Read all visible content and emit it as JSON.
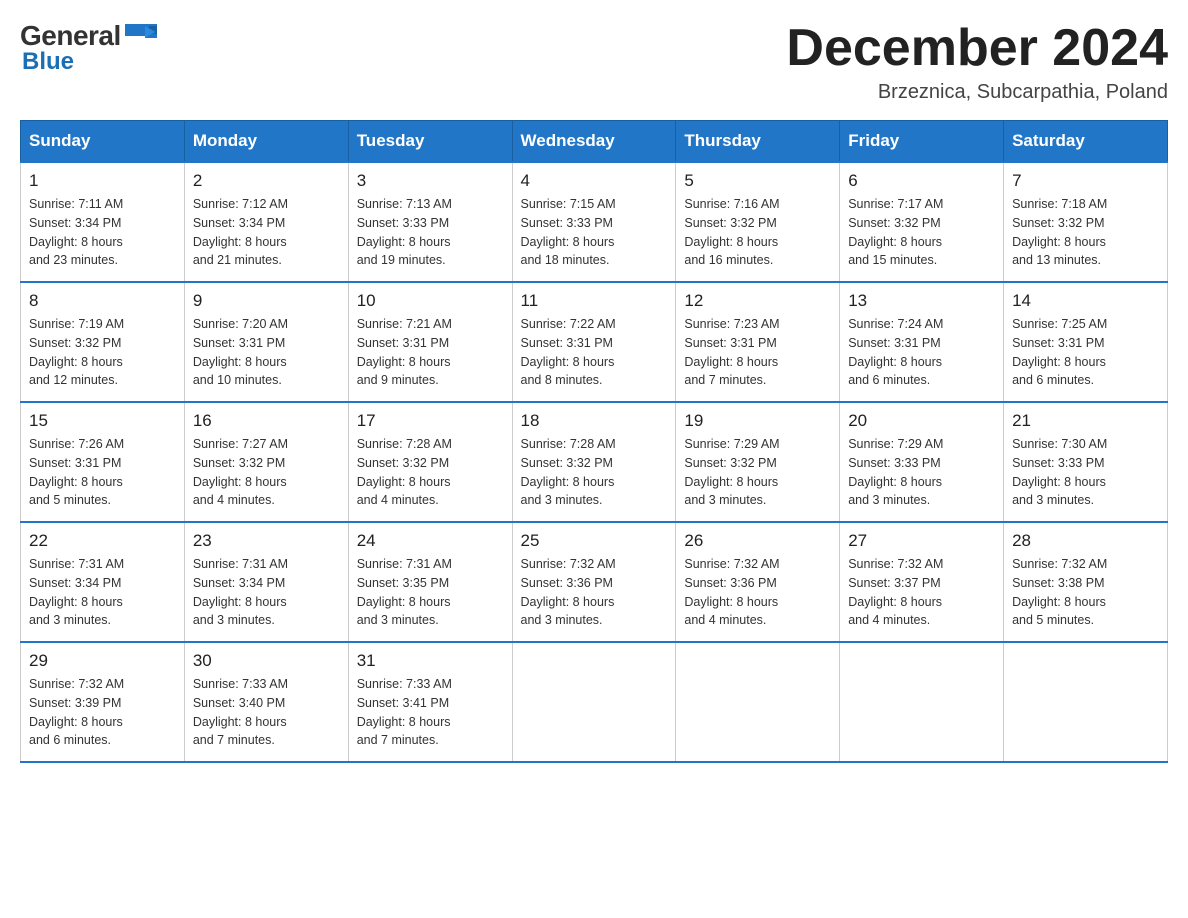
{
  "logo": {
    "general": "General",
    "blue": "Blue"
  },
  "title": "December 2024",
  "location": "Brzeznica, Subcarpathia, Poland",
  "headers": [
    "Sunday",
    "Monday",
    "Tuesday",
    "Wednesday",
    "Thursday",
    "Friday",
    "Saturday"
  ],
  "weeks": [
    [
      {
        "day": "1",
        "sunrise": "7:11 AM",
        "sunset": "3:34 PM",
        "daylight": "8 hours and 23 minutes."
      },
      {
        "day": "2",
        "sunrise": "7:12 AM",
        "sunset": "3:34 PM",
        "daylight": "8 hours and 21 minutes."
      },
      {
        "day": "3",
        "sunrise": "7:13 AM",
        "sunset": "3:33 PM",
        "daylight": "8 hours and 19 minutes."
      },
      {
        "day": "4",
        "sunrise": "7:15 AM",
        "sunset": "3:33 PM",
        "daylight": "8 hours and 18 minutes."
      },
      {
        "day": "5",
        "sunrise": "7:16 AM",
        "sunset": "3:32 PM",
        "daylight": "8 hours and 16 minutes."
      },
      {
        "day": "6",
        "sunrise": "7:17 AM",
        "sunset": "3:32 PM",
        "daylight": "8 hours and 15 minutes."
      },
      {
        "day": "7",
        "sunrise": "7:18 AM",
        "sunset": "3:32 PM",
        "daylight": "8 hours and 13 minutes."
      }
    ],
    [
      {
        "day": "8",
        "sunrise": "7:19 AM",
        "sunset": "3:32 PM",
        "daylight": "8 hours and 12 minutes."
      },
      {
        "day": "9",
        "sunrise": "7:20 AM",
        "sunset": "3:31 PM",
        "daylight": "8 hours and 10 minutes."
      },
      {
        "day": "10",
        "sunrise": "7:21 AM",
        "sunset": "3:31 PM",
        "daylight": "8 hours and 9 minutes."
      },
      {
        "day": "11",
        "sunrise": "7:22 AM",
        "sunset": "3:31 PM",
        "daylight": "8 hours and 8 minutes."
      },
      {
        "day": "12",
        "sunrise": "7:23 AM",
        "sunset": "3:31 PM",
        "daylight": "8 hours and 7 minutes."
      },
      {
        "day": "13",
        "sunrise": "7:24 AM",
        "sunset": "3:31 PM",
        "daylight": "8 hours and 6 minutes."
      },
      {
        "day": "14",
        "sunrise": "7:25 AM",
        "sunset": "3:31 PM",
        "daylight": "8 hours and 6 minutes."
      }
    ],
    [
      {
        "day": "15",
        "sunrise": "7:26 AM",
        "sunset": "3:31 PM",
        "daylight": "8 hours and 5 minutes."
      },
      {
        "day": "16",
        "sunrise": "7:27 AM",
        "sunset": "3:32 PM",
        "daylight": "8 hours and 4 minutes."
      },
      {
        "day": "17",
        "sunrise": "7:28 AM",
        "sunset": "3:32 PM",
        "daylight": "8 hours and 4 minutes."
      },
      {
        "day": "18",
        "sunrise": "7:28 AM",
        "sunset": "3:32 PM",
        "daylight": "8 hours and 3 minutes."
      },
      {
        "day": "19",
        "sunrise": "7:29 AM",
        "sunset": "3:32 PM",
        "daylight": "8 hours and 3 minutes."
      },
      {
        "day": "20",
        "sunrise": "7:29 AM",
        "sunset": "3:33 PM",
        "daylight": "8 hours and 3 minutes."
      },
      {
        "day": "21",
        "sunrise": "7:30 AM",
        "sunset": "3:33 PM",
        "daylight": "8 hours and 3 minutes."
      }
    ],
    [
      {
        "day": "22",
        "sunrise": "7:31 AM",
        "sunset": "3:34 PM",
        "daylight": "8 hours and 3 minutes."
      },
      {
        "day": "23",
        "sunrise": "7:31 AM",
        "sunset": "3:34 PM",
        "daylight": "8 hours and 3 minutes."
      },
      {
        "day": "24",
        "sunrise": "7:31 AM",
        "sunset": "3:35 PM",
        "daylight": "8 hours and 3 minutes."
      },
      {
        "day": "25",
        "sunrise": "7:32 AM",
        "sunset": "3:36 PM",
        "daylight": "8 hours and 3 minutes."
      },
      {
        "day": "26",
        "sunrise": "7:32 AM",
        "sunset": "3:36 PM",
        "daylight": "8 hours and 4 minutes."
      },
      {
        "day": "27",
        "sunrise": "7:32 AM",
        "sunset": "3:37 PM",
        "daylight": "8 hours and 4 minutes."
      },
      {
        "day": "28",
        "sunrise": "7:32 AM",
        "sunset": "3:38 PM",
        "daylight": "8 hours and 5 minutes."
      }
    ],
    [
      {
        "day": "29",
        "sunrise": "7:32 AM",
        "sunset": "3:39 PM",
        "daylight": "8 hours and 6 minutes."
      },
      {
        "day": "30",
        "sunrise": "7:33 AM",
        "sunset": "3:40 PM",
        "daylight": "8 hours and 7 minutes."
      },
      {
        "day": "31",
        "sunrise": "7:33 AM",
        "sunset": "3:41 PM",
        "daylight": "8 hours and 7 minutes."
      },
      null,
      null,
      null,
      null
    ]
  ],
  "labels": {
    "sunrise": "Sunrise:",
    "sunset": "Sunset:",
    "daylight": "Daylight:"
  }
}
